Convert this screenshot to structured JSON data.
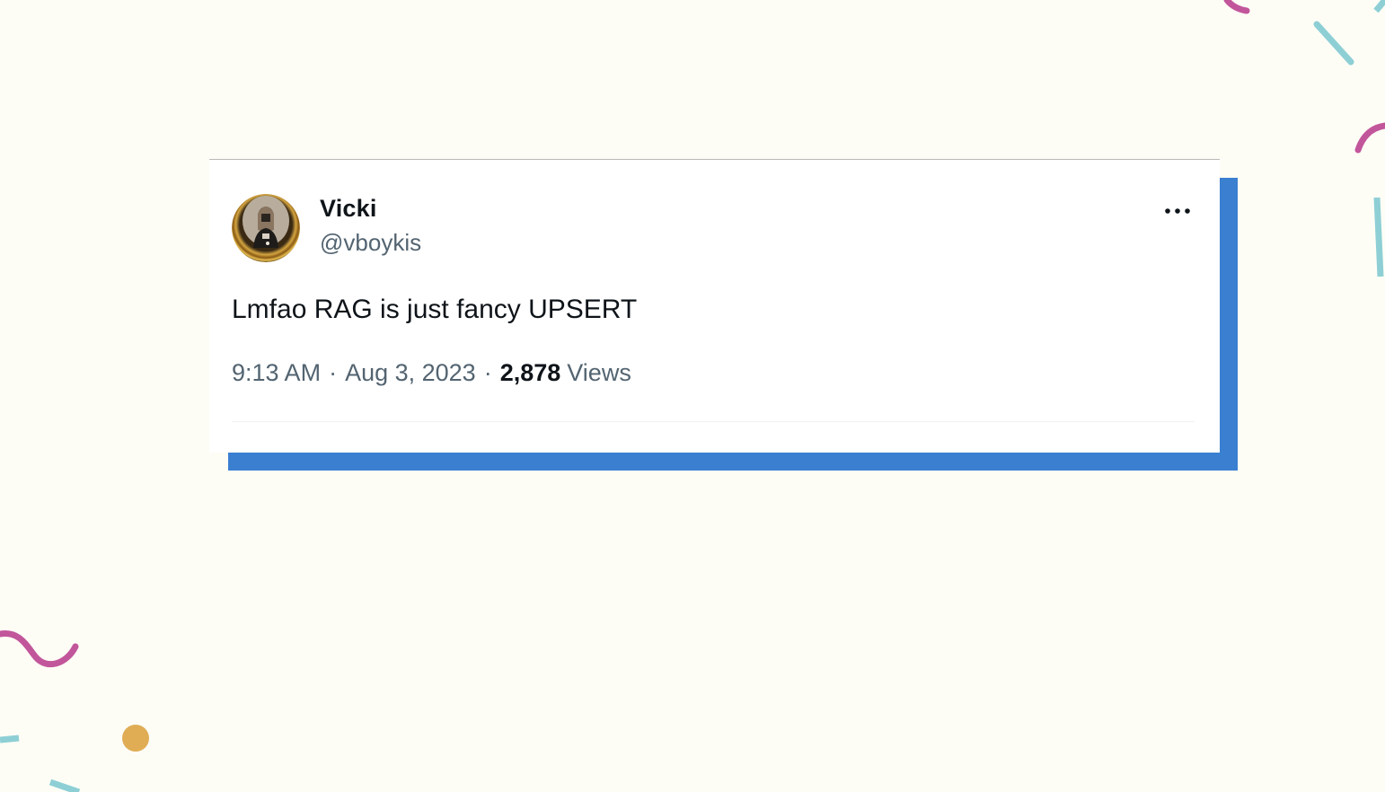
{
  "theme": {
    "background": "#fdfdf6",
    "card_shadow": "#3a7fd0",
    "confetti_pink": "#c2569b",
    "confetti_teal": "#8ecfd5",
    "confetti_gold": "#e0ad55"
  },
  "tweet": {
    "display_name": "Vicki",
    "handle": "@vboykis",
    "text": "Lmfao RAG is just fancy UPSERT",
    "time": "9:13 AM",
    "separator": "·",
    "date": "Aug 3, 2023",
    "views_count": "2,878",
    "views_label": "Views",
    "avatar_icon": "user-avatar-photo",
    "more_icon": "more-options-ellipsis-icon"
  }
}
